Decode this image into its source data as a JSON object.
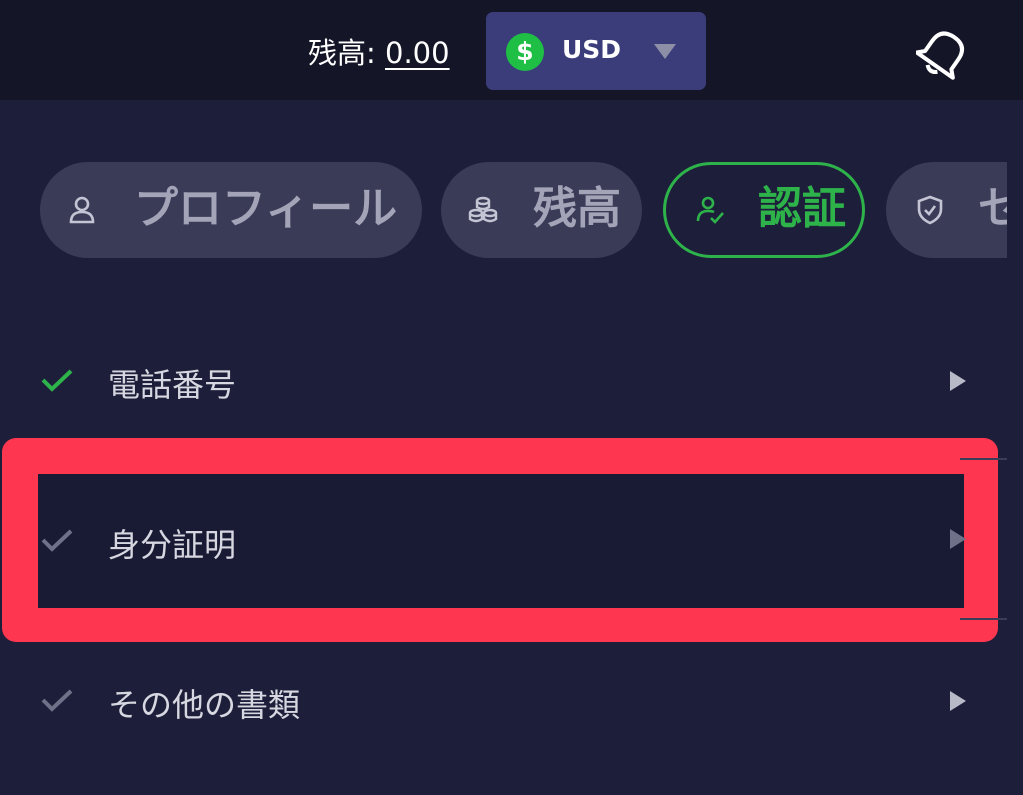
{
  "header": {
    "balance_label": "残高: ",
    "balance_value": "0.00",
    "currency_symbol": "$",
    "currency_code": "USD",
    "bell_icon": "bell-icon"
  },
  "tabs": [
    {
      "label": "プロフィール",
      "icon": "user-icon"
    },
    {
      "label": "残高",
      "icon": "coins-icon"
    },
    {
      "label": "認証",
      "icon": "user-check-icon",
      "active": true
    },
    {
      "label": "セ",
      "icon": "shield-icon"
    }
  ],
  "verification_items": [
    {
      "label": "電話番号",
      "verified": true
    },
    {
      "label": "身分証明",
      "verified": false
    },
    {
      "label": "その他の書類",
      "verified": false
    }
  ],
  "colors": {
    "background": "#1d1f3a",
    "topbar": "#141628",
    "accent_green": "#2eb34b",
    "highlight": "#ff3650",
    "currency_button": "#3b3c7a"
  }
}
